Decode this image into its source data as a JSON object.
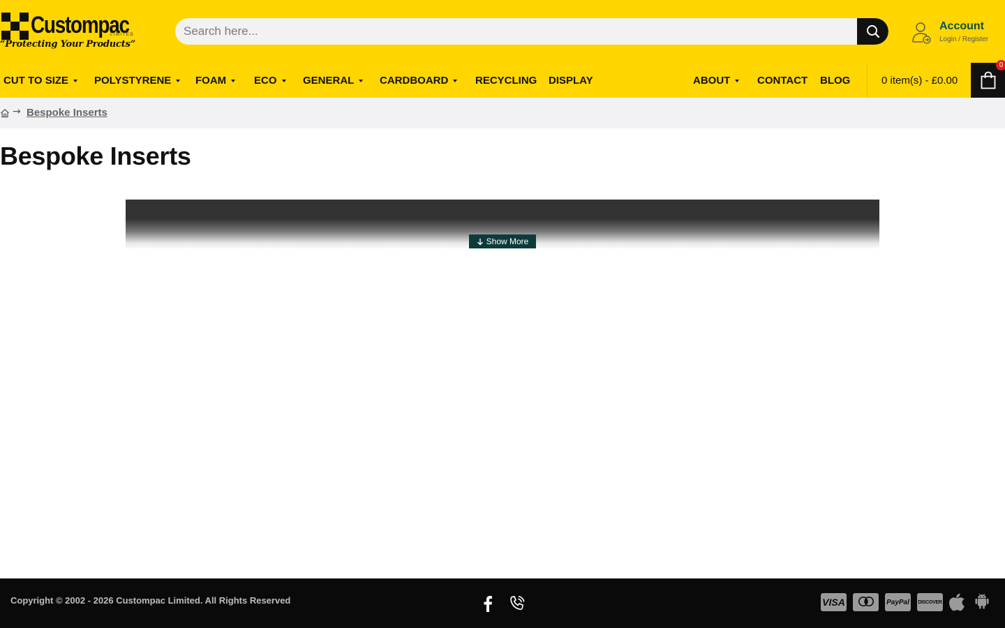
{
  "header": {
    "logo_word": "Custompac",
    "logo_limited": "LIMITED",
    "logo_tagline": "“Protecting Your Products”",
    "search_placeholder": "Search here...",
    "account_title": "Account",
    "account_sub": "Login / Register"
  },
  "nav": {
    "items": [
      {
        "label": "CUT TO SIZE",
        "dropdown": true
      },
      {
        "label": "POLYSTYRENE",
        "dropdown": true
      },
      {
        "label": "FOAM",
        "dropdown": true
      },
      {
        "label": "ECO",
        "dropdown": true
      },
      {
        "label": "GENERAL",
        "dropdown": true
      },
      {
        "label": "CARDBOARD",
        "dropdown": true
      },
      {
        "label": "RECYCLING",
        "dropdown": false
      },
      {
        "label": "DISPLAY",
        "dropdown": false
      },
      {
        "label": "ABOUT",
        "dropdown": true
      },
      {
        "label": "CONTACT",
        "dropdown": false
      },
      {
        "label": "BLOG",
        "dropdown": false
      }
    ],
    "cart_text": "0 item(s) - £0.00",
    "cart_count": "0"
  },
  "breadcrumb": {
    "current": "Bespoke Inserts"
  },
  "main": {
    "title": "Bespoke Inserts",
    "show_more": "Show More"
  },
  "footer": {
    "copyright": "Copyright © 2002 - 2026 Custompac Limited. All Rights Reserved",
    "payments": {
      "visa": "VISA",
      "paypal": "PayPal",
      "discover": "DISCOVER"
    }
  },
  "colors": {
    "brand_yellow": "#ffd600",
    "accent_teal": "#0d3b3a",
    "badge_red": "#e01b1b"
  }
}
